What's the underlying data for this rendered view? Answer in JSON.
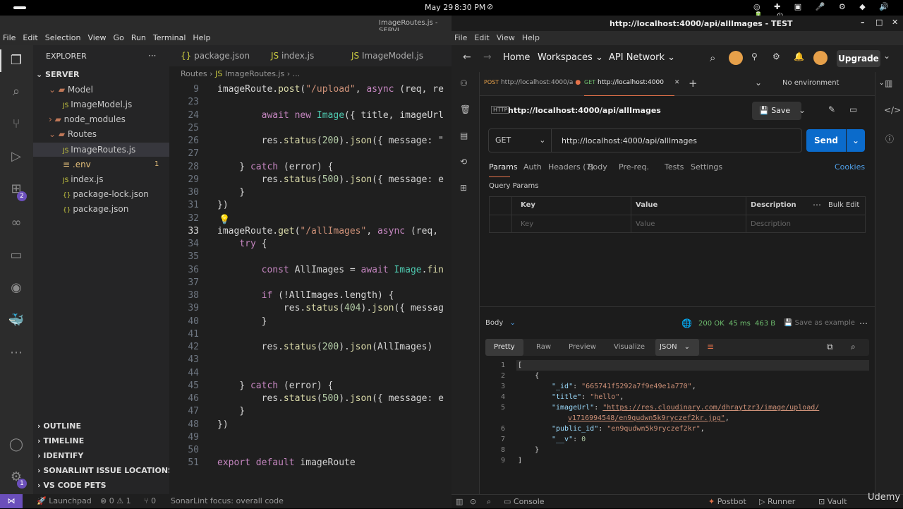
{
  "system": {
    "date": "May 29",
    "time": "8:30 PM"
  },
  "vscode": {
    "title": "ImageRoutes.js - SERVI",
    "menu": [
      "File",
      "Edit",
      "Selection",
      "View",
      "Go",
      "Run",
      "Terminal",
      "Help"
    ],
    "explorer_label": "EXPLORER",
    "explorer_more": "···",
    "root": "SERVER",
    "tree": [
      {
        "label": "Model",
        "kind": "folder",
        "open": true
      },
      {
        "label": "ImageModel.js",
        "kind": "js"
      },
      {
        "label": "node_modules",
        "kind": "folder",
        "open": false
      },
      {
        "label": "Routes",
        "kind": "folder",
        "open": true
      },
      {
        "label": "ImageRoutes.js",
        "kind": "js",
        "active": true
      },
      {
        "label": ".env",
        "kind": "env",
        "badge": "1"
      },
      {
        "label": "index.js",
        "kind": "js"
      },
      {
        "label": "package-lock.json",
        "kind": "json"
      },
      {
        "label": "package.json",
        "kind": "json"
      }
    ],
    "sections": [
      "OUTLINE",
      "TIMELINE",
      "IDENTIFY",
      "SONARLINT ISSUE LOCATIONS",
      "VS CODE PETS"
    ],
    "activity_badges": {
      "extensions": "2",
      "settings": "1"
    },
    "tabs": [
      "package.json",
      "index.js",
      "ImageModel.js"
    ],
    "breadcrumb": {
      "folder": "Routes",
      "file": "ImageRoutes.js",
      "tail": "..."
    },
    "code": [
      {
        "n": "9",
        "t": "imageRoute.post(\"/upload\", async (req, re"
      },
      {
        "n": "23",
        "t": ""
      },
      {
        "n": "24",
        "t": "        await new Image({ title, imageUrl"
      },
      {
        "n": "25",
        "t": ""
      },
      {
        "n": "26",
        "t": "        res.status(200).json({ message: \""
      },
      {
        "n": "27",
        "t": ""
      },
      {
        "n": "28",
        "t": "    } catch (error) {"
      },
      {
        "n": "29",
        "t": "        res.status(500).json({ message: e"
      },
      {
        "n": "30",
        "t": "    }"
      },
      {
        "n": "31",
        "t": "})"
      },
      {
        "n": "32",
        "t": ""
      },
      {
        "n": "33",
        "t": "imageRoute.get(\"/allImages\", async (req,"
      },
      {
        "n": "34",
        "t": "    try {"
      },
      {
        "n": "35",
        "t": ""
      },
      {
        "n": "36",
        "t": "        const AllImages = await Image.fin"
      },
      {
        "n": "37",
        "t": ""
      },
      {
        "n": "38",
        "t": "        if (!AllImages.length) {"
      },
      {
        "n": "39",
        "t": "            res.status(404).json({ messag"
      },
      {
        "n": "40",
        "t": "        }"
      },
      {
        "n": "41",
        "t": ""
      },
      {
        "n": "42",
        "t": "        res.status(200).json(AllImages)"
      },
      {
        "n": "43",
        "t": ""
      },
      {
        "n": "44",
        "t": ""
      },
      {
        "n": "45",
        "t": "    } catch (error) {"
      },
      {
        "n": "46",
        "t": "        res.status(500).json({ message: e"
      },
      {
        "n": "47",
        "t": "    }"
      },
      {
        "n": "48",
        "t": "})"
      },
      {
        "n": "49",
        "t": ""
      },
      {
        "n": "50",
        "t": ""
      },
      {
        "n": "51",
        "t": "export default imageRoute"
      }
    ],
    "status": {
      "launchpad": "Launchpad",
      "problems": "0",
      "warnings": "1",
      "ports": "0",
      "sonar": "SonarLint focus: overall code"
    }
  },
  "postman": {
    "title": "http://localhost:4000/api/allImages - TEST",
    "menu": [
      "File",
      "Edit",
      "View",
      "Help"
    ],
    "nav": {
      "home": "Home",
      "workspaces": "Workspaces",
      "network": "API Network",
      "upgrade": "Upgrade"
    },
    "tabs": [
      {
        "method": "POST",
        "label": "http://localhost:4000/a"
      },
      {
        "method": "GET",
        "label": "http://localhost:4000"
      }
    ],
    "env": "No environment",
    "request_name": "http://localhost:4000/api/allImages",
    "save": "Save",
    "method": "GET",
    "url": "http://localhost:4000/api/allImages",
    "send": "Send",
    "req_tabs": [
      "Params",
      "Auth",
      "Headers (7)",
      "Body",
      "Pre-req.",
      "Tests",
      "Settings"
    ],
    "cookies": "Cookies",
    "query_params": "Query Params",
    "table_headers": [
      "Key",
      "Value",
      "Description"
    ],
    "bulk_edit": "Bulk Edit",
    "placeholders": {
      "key": "Key",
      "value": "Value",
      "description": "Description"
    },
    "response": {
      "label": "Body",
      "status": "200 OK",
      "time": "45 ms",
      "size": "463 B",
      "save_example": "Save as example",
      "views": [
        "Pretty",
        "Raw",
        "Preview",
        "Visualize"
      ],
      "format": "JSON",
      "lines": [
        {
          "n": "1",
          "t": "["
        },
        {
          "n": "2",
          "t": "    {"
        },
        {
          "n": "3",
          "k": "\"_id\"",
          "v": "\"665741f5292a7f9e49e1a770\"",
          "c": ","
        },
        {
          "n": "4",
          "k": "\"title\"",
          "v": "\"hello\"",
          "c": ","
        },
        {
          "n": "5",
          "k": "\"imageUrl\"",
          "v": "\"https://res.cloudinary.com/dhraytzr3/image/upload/",
          "c": ""
        },
        {
          "n": "",
          "v2": "v1716994548/en9qudwn5k9ryczef2kr.jpg\"",
          "c": ","
        },
        {
          "n": "6",
          "k": "\"public_id\"",
          "v": "\"en9qudwn5k9ryczef2kr\"",
          "c": ","
        },
        {
          "n": "7",
          "k": "\"__v\"",
          "num": "0",
          "c": ""
        },
        {
          "n": "8",
          "t": "    }"
        },
        {
          "n": "9",
          "t": "]"
        }
      ]
    },
    "status_bar": {
      "console": "Console",
      "postbot": "Postbot",
      "runner": "Runner",
      "vault": "Vault",
      "udemy": "Udemy"
    }
  }
}
